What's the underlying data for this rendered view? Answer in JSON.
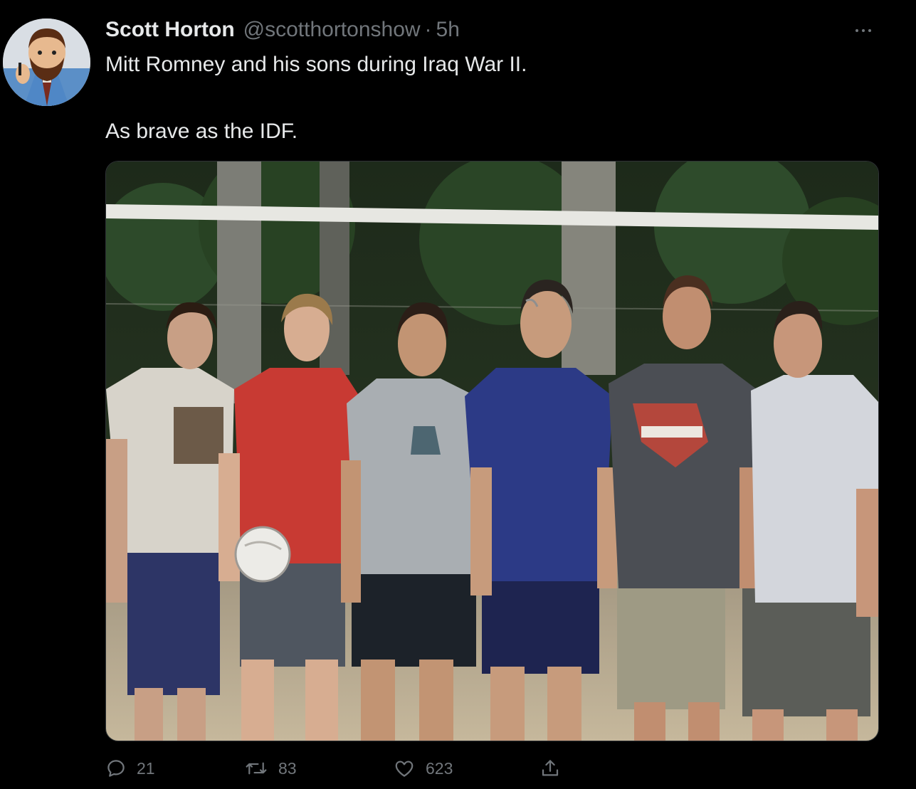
{
  "tweet": {
    "author_name": "Scott Horton",
    "handle": "@scotthortonshow",
    "separator": "·",
    "time": "5h",
    "text_line1": "Mitt Romney and his sons during Iraq War II.",
    "text_line2": "As brave as the IDF.",
    "media_image": "photo-six-men-volleyball-court",
    "more_icon": "ellipsis-icon"
  },
  "actions": {
    "reply_count": "21",
    "retweet_count": "83",
    "like_count": "623",
    "reply_icon": "reply-icon",
    "retweet_icon": "retweet-icon",
    "like_icon": "heart-icon",
    "share_icon": "share-icon"
  },
  "colors": {
    "background": "#000000",
    "primary_text": "#e7e9ea",
    "secondary_text": "#71767b"
  }
}
